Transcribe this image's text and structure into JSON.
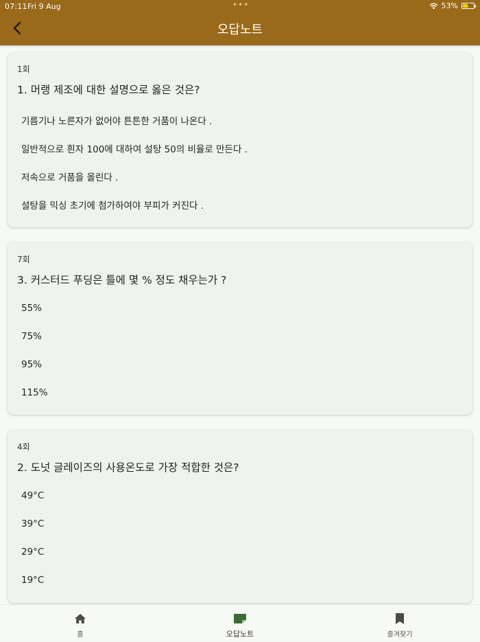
{
  "status_bar": {
    "time": "07:11",
    "date": "Fri 9 Aug",
    "battery": "53%",
    "battery_level": 0.53
  },
  "header": {
    "title": "오답노트"
  },
  "cards": [
    {
      "round": "1회",
      "question": "1. 머랭 제조에 대한 설명으로 옳은 것은?",
      "options": [
        "기름기나 노른자가 없어야 튼튼한 거품이 나온다 .",
        "일반적으로 흰자 100에 대하여 설탕 50의 비율로 만든다 .",
        "저속으로 거품을 올린다 .",
        "설탕을 믹싱 초기에 첨가하여야 부피가 커진다 ."
      ]
    },
    {
      "round": "7회",
      "question": "3. 커스터드 푸딩은 틀에 몇 % 정도 채우는가 ?",
      "options": [
        "55%",
        "75%",
        "95%",
        "115%"
      ]
    },
    {
      "round": "4회",
      "question": "2. 도넛 글레이즈의 사용온도로 가장 적합한 것은?",
      "options": [
        "49°C",
        "39°C",
        "29°C",
        "19°C"
      ]
    }
  ],
  "bottom_nav": {
    "items": [
      {
        "label": "홈",
        "icon": "home-icon"
      },
      {
        "label": "오답노트",
        "icon": "note-icon"
      },
      {
        "label": "즐겨찾기",
        "icon": "bookmark-icon"
      }
    ]
  },
  "colors": {
    "header_bg": "#9a6a1b",
    "active_icon": "#3e6b35",
    "inactive_icon": "#555555"
  }
}
